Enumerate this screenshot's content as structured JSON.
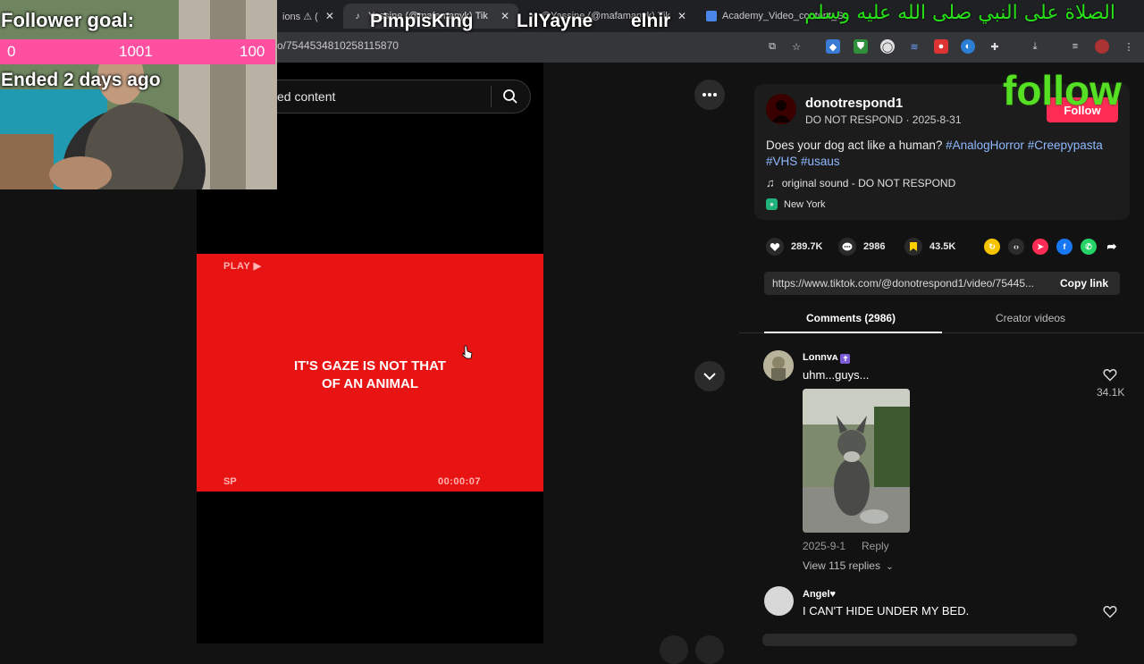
{
  "browser": {
    "tabs": [
      {
        "label": "ions ⚠ (",
        "active": false
      },
      {
        "label": "Yassine (@mafamanyk) Tik",
        "active": true
      },
      {
        "label": "@Yassine (@mafamanyk) Tik",
        "active": false
      },
      {
        "label": "Academy_Video_content_Sc",
        "active": false
      }
    ],
    "url": "o/7544534810258115870"
  },
  "search": {
    "text": "ed content"
  },
  "video": {
    "play_label": "PLAY ▶",
    "caption_line1": "IT'S GAZE IS NOT THAT",
    "caption_line2": "OF AN ANIMAL",
    "sp_label": "SP",
    "timecode": "00:00:07"
  },
  "post": {
    "username": "donotrespond1",
    "subline": "DO NOT RESPOND · 2025-8-31",
    "follow_label": "Follow",
    "description_text": "Does your dog act like a human? ",
    "hashtags_line1": [
      "#AnalogHorror",
      "#Creepypasta"
    ],
    "hashtags_line2": [
      "#VHS",
      "#usaus"
    ],
    "sound": "original sound - DO NOT RESPOND",
    "location": "New York",
    "likes": "289.7K",
    "comments": "2986",
    "saves": "43.5K",
    "link": "https://www.tiktok.com/@donotrespond1/video/75445...",
    "copy_link_label": "Copy link"
  },
  "tabs": {
    "comments": "Comments (2986)",
    "creator": "Creator videos"
  },
  "comments": [
    {
      "name": "Lonnvᴀ",
      "text": "uhm...guys...",
      "date": "2025-9-1",
      "reply_label": "Reply",
      "likes": "34.1K",
      "view_replies": "View 115 replies"
    },
    {
      "name": "Angel♥",
      "text": "I CAN'T HIDE UNDER MY BED."
    }
  ],
  "overlay": {
    "goal_title": "Follower goal:",
    "goal_low": "0",
    "goal_current": "1001",
    "goal_high": "100",
    "goal_ended": "Ended 2 days ago",
    "stream_names": [
      "PimpisKing",
      "LilYayne",
      "elnir"
    ],
    "arabic_banner": "الصلاة على النبي صلى الله عليه وسلم",
    "follow_text": "follow"
  },
  "colors": {
    "accent_pink": "#fe2c55",
    "video_red": "#e81414",
    "overlay_green": "#56e024",
    "hashtag_blue": "#8fb8ff"
  }
}
